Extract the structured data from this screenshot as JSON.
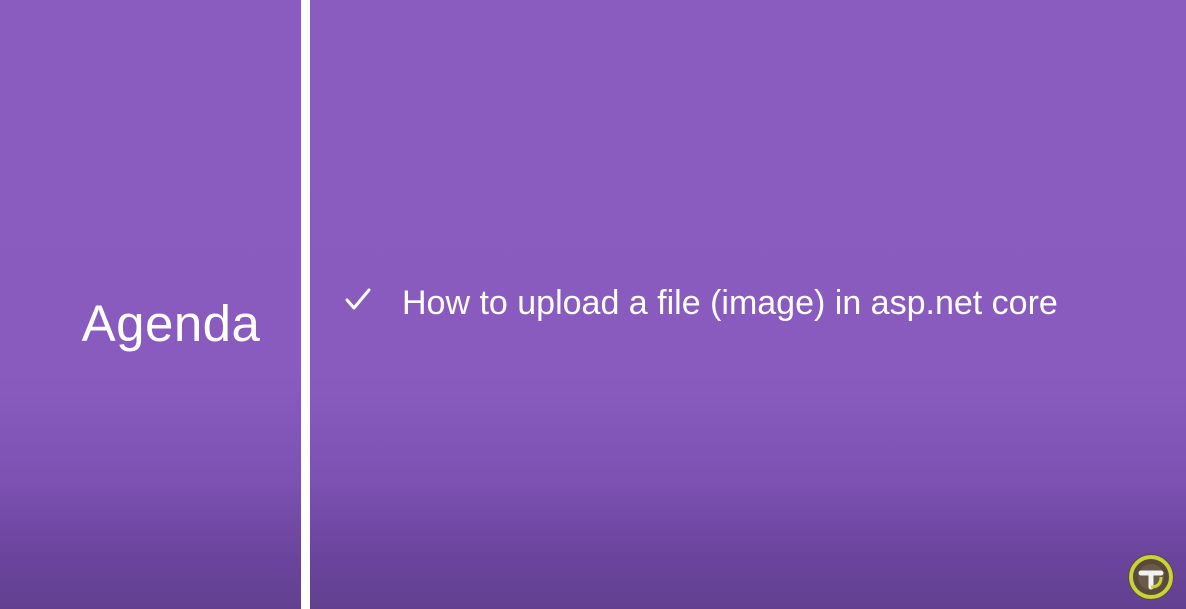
{
  "slide": {
    "title": "Agenda",
    "bullets": [
      {
        "text": "How to upload a file (image) in asp.net core",
        "icon": "checkmark-icon"
      }
    ]
  },
  "logo": {
    "icon": "channel-logo-icon"
  },
  "colors": {
    "background": "#8a5cc0",
    "divider": "#ffffff",
    "text": "#ffffff"
  }
}
